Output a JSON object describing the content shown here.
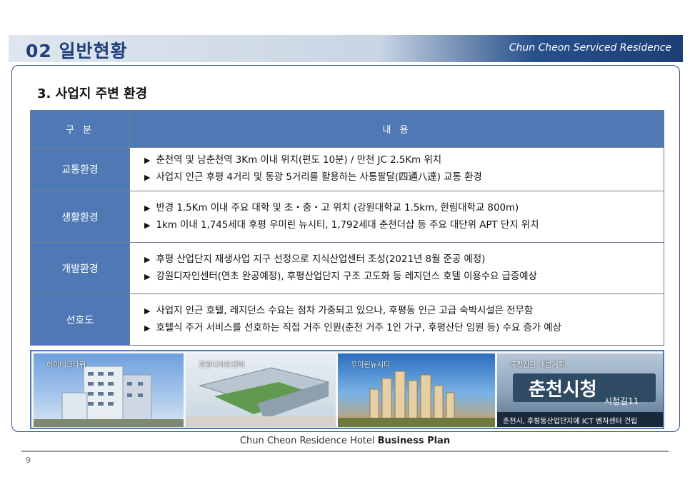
{
  "header": {
    "title": "02 일반현황",
    "subtitle": "Chun Cheon  Serviced Residence"
  },
  "section": {
    "title": "3. 사업지 주변 환경"
  },
  "table": {
    "headers": [
      "구 분",
      "내 용"
    ],
    "rows": [
      {
        "category": "교통환경",
        "lines": [
          "춘천역  및 남춘천역 3Km 이내 위치(편도 10분) / 만천 JC  2.5Km 위치",
          "사업지 인근 후평 4거리 및 동광 5거리를 활용하는 사통팔달(四通八達) 교통 환경"
        ]
      },
      {
        "category": "생활환경",
        "lines": [
          "반경 1.5Km 이내 주요 대학 및 초・중・고 위치 (강원대학교 1.5km, 한림대학교 800m)",
          "1km 이내 1,745세대 후평 우미린 뉴시티, 1,792세대 춘천더샵 등 주요 대단위 APT 단지 위치"
        ]
      },
      {
        "category": "개발환경",
        "lines": [
          "후평 산업단지 재생사업 지구 선정으로 지식산업센터 조성(2021년 8월 준공 예정)",
          "강원디자인센터(연초 완공예정), 후평산업단지 구조 고도화 등 레지던스 호텔 이용수요 급증예상"
        ]
      },
      {
        "category": "선호도",
        "lines": [
          "사업지 인근 호텔, 레지던스 수요는 점차 가중되고 있으나, 후평동 인근 고급 숙박시설은 전무함",
          "호텔식 주거 서비스를 선호하는 직접 거주 인원(춘천 거주 1인 가구, 후평산단 임원 등) 수요 증가 예상"
        ]
      }
    ],
    "bullet": "▶"
  },
  "photos": [
    {
      "label": "하이테크타워"
    },
    {
      "label": "강원디자인센터"
    },
    {
      "label": "우미린뉴시티"
    },
    {
      "label": "후평산단 개발계획",
      "sign": "춘천시청",
      "sign_sub": "시청길11",
      "caption": "춘천시, 후평동산업단지에 ICT 벤처센터 건립"
    }
  ],
  "footer": {
    "text_normal": "Chun Cheon  Residence Hotel ",
    "text_bold": "Business Plan",
    "page_number": "9"
  }
}
